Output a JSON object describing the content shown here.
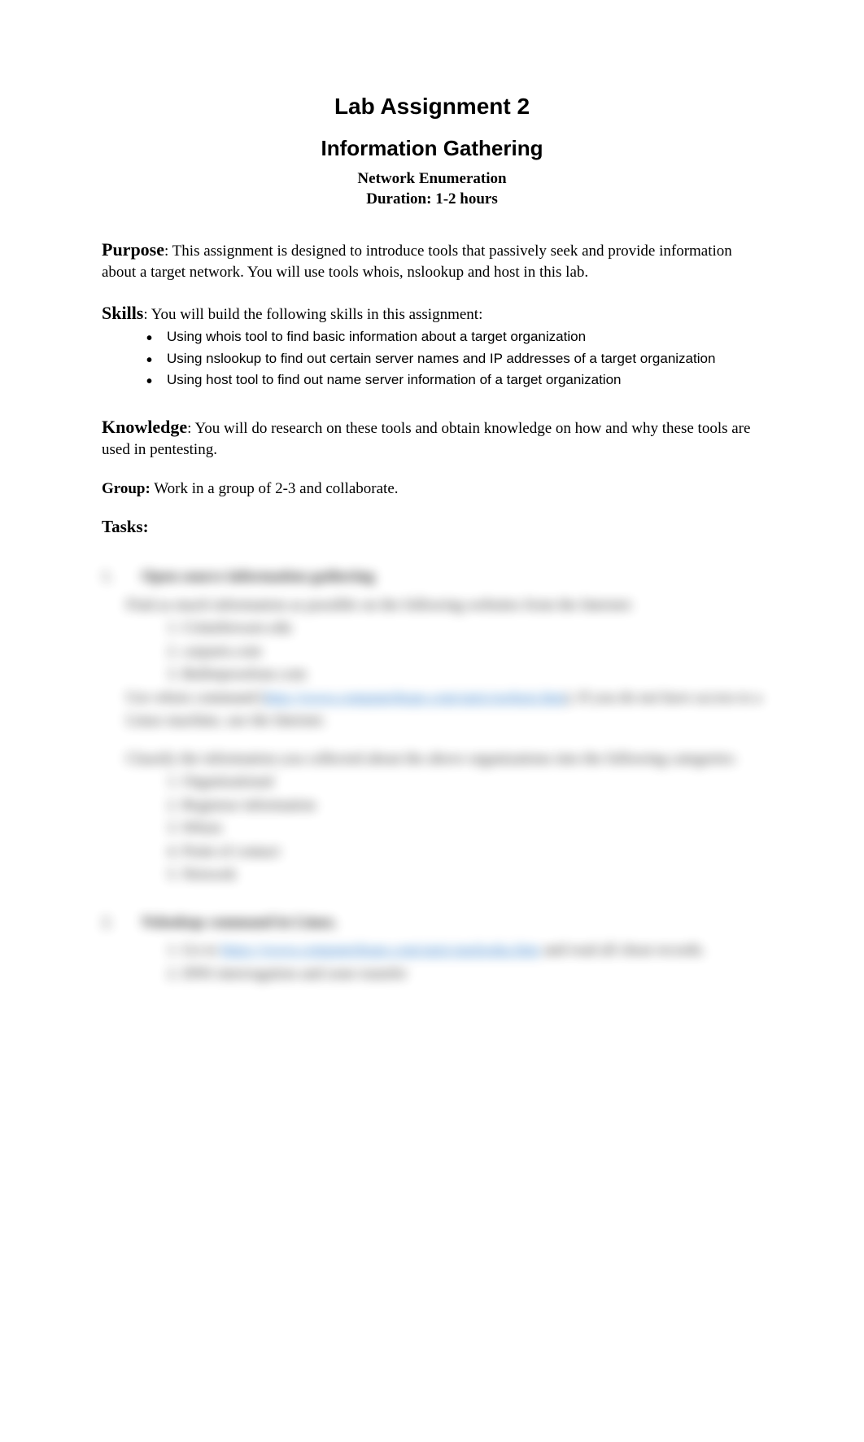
{
  "header": {
    "title1": "Lab Assignment 2",
    "title2": "Information Gathering",
    "subtitle_line1": "Network Enumeration",
    "subtitle_line2": "Duration: 1-2 hours"
  },
  "sections": {
    "purpose": {
      "label": "Purpose",
      "text": ": This assignment is designed to introduce tools that passively seek and provide information about a target network. You will use tools whois, nslookup and host in this lab."
    },
    "skills": {
      "label": "Skills",
      "text": ": You will build the following skills in this assignment:",
      "items": [
        "Using whois tool to find basic information about a target organization",
        "Using nslookup to find out certain server names and IP addresses of a target organization",
        "Using host tool to find out name server information of a target organization"
      ]
    },
    "knowledge": {
      "label": "Knowledge",
      "text": ": You will do research on these tools and obtain knowledge on how and why these tools are used in pentesting."
    },
    "group": {
      "label": "Group:",
      "text": " Work in a group of 2-3 and collaborate."
    },
    "tasks": {
      "label": "Tasks:"
    }
  },
  "blurred": {
    "block1": {
      "num": "1.",
      "heading": "Open source information gathering",
      "line1": "Find as much information as possible on the following websites from the Internet:",
      "sub1": "1. Crimebeware.edu",
      "sub2": "2. carparts.com",
      "sub3": "3. Bulletproofone.com",
      "line2a": "Use whois command (",
      "link1": "http://www.computerhope.com/unix/uwhois.htm",
      "line2b": "). If you do not have access to a Linux machine, use the Internet.",
      "line3": "Classify the information you collected about the above organizations into the following categories:",
      "cat1": "1. Organizational",
      "cat2": "2. Registrar information",
      "cat3": "3. Whois",
      "cat4": "4. Point of contact",
      "cat5": "5. Network"
    },
    "block2": {
      "num": "2.",
      "heading": "Nslookup command in Linux.",
      "line1a": "1. Go to ",
      "link1": "https://www.computerhope.com/unix/unslooku.htm",
      "line1b": " and read all cheat records.",
      "line2": "2. DNS interrogation and zone transfer"
    }
  }
}
